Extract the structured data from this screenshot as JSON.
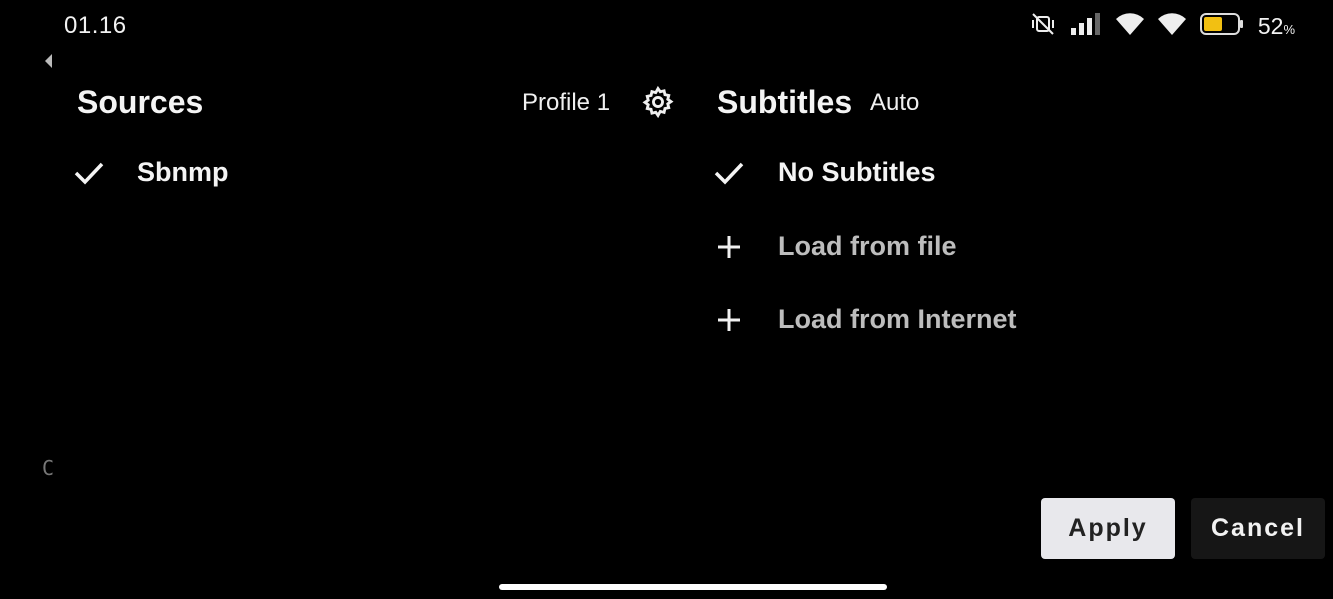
{
  "status_bar": {
    "time": "01.16",
    "battery_value": "52",
    "battery_unit": "%",
    "icons": [
      "mute-vibrate-icon",
      "signal-icon",
      "wifi-icon",
      "wifi-icon",
      "battery-icon"
    ],
    "battery_color": "#f2c012"
  },
  "sources": {
    "title": "Sources",
    "profile": "Profile 1",
    "items": [
      {
        "label": "Sbnmp",
        "selected": true
      }
    ]
  },
  "subtitles": {
    "title": "Subtitles",
    "mode": "Auto",
    "items": [
      {
        "label": "No Subtitles",
        "icon": "check-icon"
      },
      {
        "label": "Load from file",
        "icon": "plus-icon"
      },
      {
        "label": "Load from Internet",
        "icon": "plus-icon"
      }
    ]
  },
  "side_letter": "C",
  "buttons": {
    "apply": "Apply",
    "cancel": "Cancel"
  }
}
